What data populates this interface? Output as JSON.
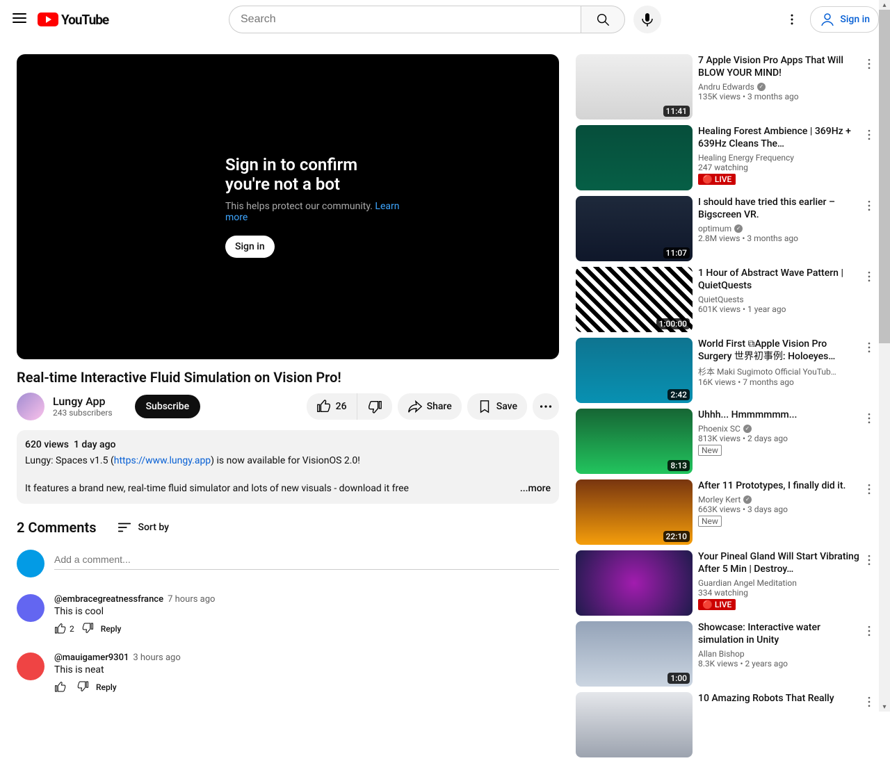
{
  "header": {
    "logo_text": "YouTube",
    "search_placeholder": "Search",
    "signin_label": "Sign in"
  },
  "player": {
    "title": "Sign in to confirm you're not a bot",
    "subtitle": "This helps protect our community.",
    "learn_more": "Learn more",
    "signin": "Sign in"
  },
  "video": {
    "title": "Real-time Interactive Fluid Simulation on Vision Pro!",
    "channel_name": "Lungy App",
    "sub_count": "243 subscribers",
    "subscribe_label": "Subscribe",
    "like_count": "26",
    "share_label": "Share",
    "save_label": "Save"
  },
  "description": {
    "views": "620 views",
    "age": "1 day ago",
    "line1_pre": "Lungy: Spaces v1.5 (",
    "line1_link": "https://www.lungy.app",
    "line1_post": ") is now available for VisionOS 2.0!",
    "line2": "It features a brand new, real-time fluid simulator and lots of new visuals - download it free",
    "more": "...more"
  },
  "comments_header": {
    "count_label": "2 Comments",
    "sort_label": "Sort by",
    "add_placeholder": "Add a comment..."
  },
  "comments": [
    {
      "author": "@embracegreatnessfrance",
      "when": "7 hours ago",
      "body": "This is cool",
      "likes": "2",
      "reply": "Reply"
    },
    {
      "author": "@mauigamer9301",
      "when": "3 hours ago",
      "body": "This is neat",
      "likes": "",
      "reply": "Reply"
    }
  ],
  "recs": [
    {
      "title": "7 Apple Vision Pro Apps That Will BLOW YOUR MIND!",
      "channel": "Andru Edwards",
      "verified": true,
      "views": "135K views",
      "age": "3 months ago",
      "duration": "11:41",
      "live": false,
      "new": false
    },
    {
      "title": "Healing Forest Ambience | 369Hz + 639Hz Cleans The…",
      "channel": "Healing Energy Frequency",
      "verified": false,
      "views": "247 watching",
      "age": "",
      "duration": "",
      "live": true,
      "new": false
    },
    {
      "title": "I should have tried this earlier – Bigscreen VR.",
      "channel": "optimum",
      "verified": true,
      "views": "2.8M views",
      "age": "3 months ago",
      "duration": "11:07",
      "live": false,
      "new": false
    },
    {
      "title": "1 Hour of Abstract Wave Pattern | QuietQuests",
      "channel": "QuietQuests",
      "verified": false,
      "views": "601K views",
      "age": "1 year ago",
      "duration": "1:00:00",
      "live": false,
      "new": false
    },
    {
      "title": "World First ⧉Apple Vision Pro Surgery 世界初事例: Holoeyes…",
      "channel": "杉本 Maki Sugimoto Official YouTub…",
      "verified": false,
      "views": "16K views",
      "age": "7 months ago",
      "duration": "2:42",
      "live": false,
      "new": false
    },
    {
      "title": "Uhhh... Hmmmmmm...",
      "channel": "Phoenix SC",
      "verified": true,
      "views": "813K views",
      "age": "2 days ago",
      "duration": "8:13",
      "live": false,
      "new": true
    },
    {
      "title": "After 11 Prototypes, I finally did it.",
      "channel": "Morley Kert",
      "verified": true,
      "views": "663K views",
      "age": "3 days ago",
      "duration": "22:10",
      "live": false,
      "new": true
    },
    {
      "title": "Your Pineal Gland Will Start Vibrating After 5 Min | Destroy…",
      "channel": "Guardian Angel Meditation",
      "verified": false,
      "views": "334 watching",
      "age": "",
      "duration": "",
      "live": true,
      "new": false
    },
    {
      "title": "Showcase: Interactive water simulation in Unity",
      "channel": "Allan Bishop",
      "verified": false,
      "views": "8.3K views",
      "age": "2 years ago",
      "duration": "1:00",
      "live": false,
      "new": false
    },
    {
      "title": "10 Amazing Robots That Really",
      "channel": "",
      "verified": false,
      "views": "",
      "age": "",
      "duration": "",
      "live": false,
      "new": false
    }
  ]
}
